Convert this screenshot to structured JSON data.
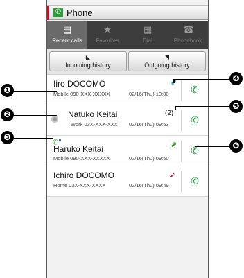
{
  "title": "Phone",
  "tabs": [
    {
      "label": "Recent calls",
      "icon": "list-icon"
    },
    {
      "label": "Favorites",
      "icon": "star-icon"
    },
    {
      "label": "Dial",
      "icon": "dialpad-icon"
    },
    {
      "label": "Phonebook",
      "icon": "phonebook-icon"
    }
  ],
  "history": {
    "incoming_label": "Incoming history",
    "outgoing_label": "Outgoing history"
  },
  "calls": [
    {
      "name": "Iiro DOCOMO",
      "number": "Mobile 090-XXX-XXXXX",
      "time": "02/16(Thu) 10:00",
      "direction_icon": "outgoing-arrow-icon",
      "count": ""
    },
    {
      "name": "Natuko Keitai",
      "number": "Work 03X-XXX-XXX",
      "time": "02/16(Thu) 09:53",
      "direction_icon": "",
      "count": "(2)"
    },
    {
      "name": "Haruko Keitai",
      "number": "Mobile 090-XXX-XXXXX",
      "time": "02/16(Thu) 09:50",
      "direction_icon": "incoming-arrow-icon",
      "count": ""
    },
    {
      "name": "Ichiro DOCOMO",
      "number": "Home 03X-XXX-XXXX",
      "time": "02/16(Thu) 09:49",
      "direction_icon": "missed-arrow-icon",
      "count": ""
    }
  ],
  "callouts": [
    "❶",
    "❷",
    "❸",
    "❹",
    "❺",
    "❻"
  ],
  "colors": {
    "call_green": "#1a9b3a",
    "outgoing_blue": "#3aa0d8",
    "incoming_green": "#3a9a2a",
    "missed_red": "#d0103a",
    "tab_bg": "#3d3d3d"
  }
}
